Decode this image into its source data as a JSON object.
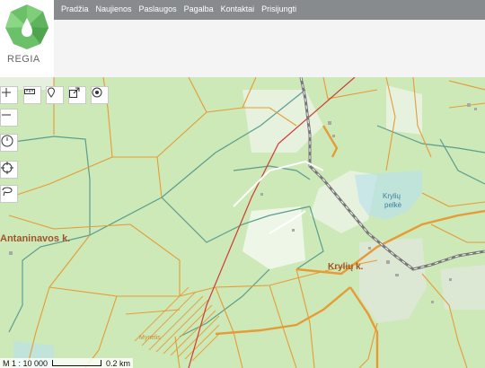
{
  "app": {
    "logo_text": "REGIA",
    "brand_color": "#5cb85c"
  },
  "nav": {
    "items": [
      "Pradžia",
      "Naujienos",
      "Paslaugos",
      "Pagalba",
      "Kontaktai",
      "Prisijungti"
    ]
  },
  "map": {
    "labels": {
      "antaninavos": "Antaninavos k.",
      "kryliu_pelke_1": "Krylių",
      "kryliu_pelke_2": "pelkė",
      "kryliu_k": "Krylių k.",
      "lower": "Mynelis"
    },
    "scale_text": "M 1 : 10 000",
    "scale_bar_text": "0.2 km"
  },
  "toolbar": {
    "icons": [
      "measure-icon",
      "marker-icon",
      "export-icon",
      "location-icon"
    ]
  },
  "sidebar": {
    "icons": [
      "zoom-in-icon",
      "zoom-out-icon",
      "history-icon",
      "target-icon",
      "lasso-icon"
    ]
  },
  "colors": {
    "forest": "#cde9b8",
    "boundary_orange": "#e69b36",
    "boundary_teal": "#5a9d8f",
    "rail": "#888",
    "red_line": "#d13a34"
  }
}
